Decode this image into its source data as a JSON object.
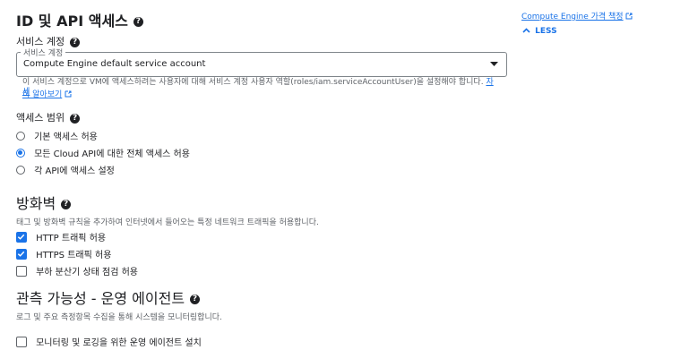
{
  "identity": {
    "title": "ID 및 API 액세스",
    "service_account_label": "서비스 계정",
    "select_float_label": "서비스 계정",
    "select_value": "Compute Engine default service account",
    "hint_text": "이 서비스 계정으로 VM에 액세스하려는 사용자에 대해 서비스 계정 사용자 역할(roles/iam.serviceAccountUser)을 설정해야 합니다.",
    "hint_link_1": "자세",
    "hint_link_2": "히 알아보기"
  },
  "access_scope": {
    "label": "액세스 범위",
    "options": [
      {
        "label": "기본 액세스 허용",
        "selected": false
      },
      {
        "label": "모든 Cloud API에 대한 전체 액세스 허용",
        "selected": true
      },
      {
        "label": "각 API에 액세스 설정",
        "selected": false
      }
    ]
  },
  "firewall": {
    "title": "방화벽",
    "description": "태그 및 방화벽 규칙을 추가하여 인터넷에서 들어오는 특정 네트워크 트래픽을 허용합니다.",
    "options": [
      {
        "label": "HTTP 트래픽 허용",
        "checked": true
      },
      {
        "label": "HTTPS 트래픽 허용",
        "checked": true
      },
      {
        "label": "부하 분산기 상태 점검 허용",
        "checked": false
      }
    ]
  },
  "observability": {
    "title": "관측 가능성 - 운영 에이전트",
    "description": "로그 및 주요 측정항목 수집을 통해 시스템을 모니터링합니다.",
    "option": {
      "label": "모니터링 및 로깅을 위한 운영 에이전트 설치",
      "checked": false
    }
  },
  "side": {
    "pricing_link": "Compute Engine 가격 책정",
    "less_label": "LESS"
  },
  "colors": {
    "accent": "#1a73e8",
    "text": "#202124",
    "muted": "#5f6368"
  }
}
